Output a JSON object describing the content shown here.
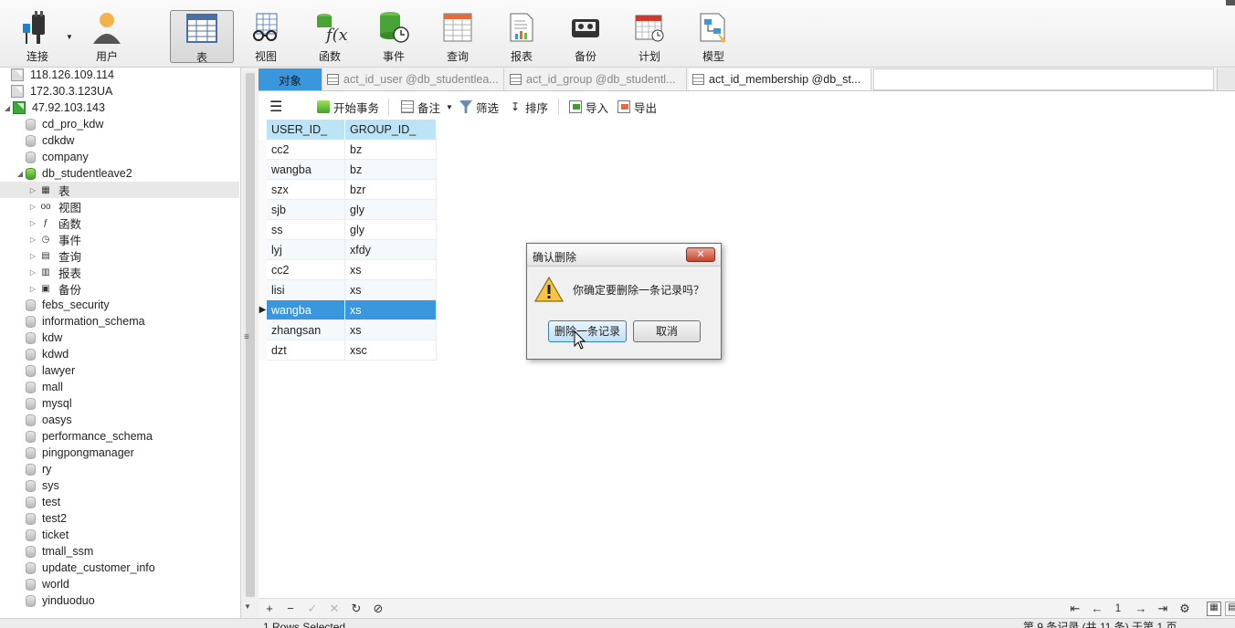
{
  "toolbar": {
    "buttons": [
      {
        "label": "连接"
      },
      {
        "label": "用户"
      },
      {
        "label": "表"
      },
      {
        "label": "视图"
      },
      {
        "label": "函数"
      },
      {
        "label": "事件"
      },
      {
        "label": "查询"
      },
      {
        "label": "报表"
      },
      {
        "label": "备份"
      },
      {
        "label": "计划"
      },
      {
        "label": "模型"
      }
    ]
  },
  "sidebar": {
    "connections": [
      "118.126.109.114",
      "172.30.3.123UA",
      "47.92.103.143"
    ],
    "databases_before": [
      "cd_pro_kdw",
      "cdkdw",
      "company"
    ],
    "open_db": "db_studentleave2",
    "objects": [
      "表",
      "视图",
      "函数",
      "事件",
      "查询",
      "报表",
      "备份"
    ],
    "databases_after": [
      "febs_security",
      "information_schema",
      "kdw",
      "kdwd",
      "lawyer",
      "mall",
      "mysql",
      "oasys",
      "performance_schema",
      "pingpongmanager",
      "ry",
      "sys",
      "test",
      "test2",
      "ticket",
      "tmall_ssm",
      "update_customer_info",
      "world",
      "yinduoduo"
    ]
  },
  "tabs": {
    "objects_label": "对象",
    "items": [
      "act_id_user @db_studentlea...",
      "act_id_group @db_studentl...",
      "act_id_membership @db_st..."
    ]
  },
  "actionbar": {
    "begin_tx": "开始事务",
    "memo": "备注",
    "filter": "筛选",
    "sort": "排序",
    "import": "导入",
    "export": "导出"
  },
  "grid": {
    "columns": [
      "USER_ID_",
      "GROUP_ID_"
    ],
    "rows": [
      [
        "cc2",
        "bz"
      ],
      [
        "wangba",
        "bz"
      ],
      [
        "szx",
        "bzr"
      ],
      [
        "sjb",
        "gly"
      ],
      [
        "ss",
        "gly"
      ],
      [
        "lyj",
        "xfdy"
      ],
      [
        "cc2",
        "xs"
      ],
      [
        "lisi",
        "xs"
      ],
      [
        "wangba",
        "xs"
      ],
      [
        "zhangsan",
        "xs"
      ],
      [
        "dzt",
        "xsc"
      ]
    ],
    "selected_row": 8
  },
  "bottombar": {
    "page": "1"
  },
  "status": {
    "left": "1 Rows Selected",
    "right": "第 9 条记录 (共 11 条) 于第 1 页"
  },
  "dialog": {
    "title": "确认删除",
    "close": "✕",
    "message": "你确定要删除一条记录吗？",
    "confirm": "删除一条记录",
    "cancel": "取消"
  }
}
